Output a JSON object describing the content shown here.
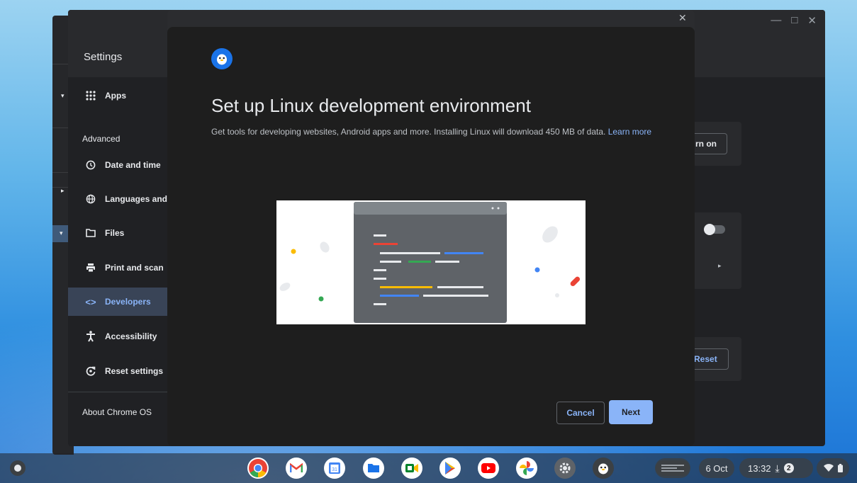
{
  "settings": {
    "title": "Settings",
    "sidebar": {
      "apps_label": "Apps",
      "advanced_heading": "Advanced",
      "items": [
        {
          "label": "Date and time",
          "icon": "clock-icon"
        },
        {
          "label": "Languages and",
          "icon": "globe-icon"
        },
        {
          "label": "Files",
          "icon": "folder-icon"
        },
        {
          "label": "Print and scan",
          "icon": "printer-icon"
        },
        {
          "label": "Developers",
          "icon": "code-icon"
        },
        {
          "label": "Accessibility",
          "icon": "accessibility-icon"
        },
        {
          "label": "Reset settings",
          "icon": "reset-icon"
        }
      ],
      "about_label": "About Chrome OS"
    },
    "content": {
      "turn_on_label": "rn on",
      "reset_label": "Reset"
    }
  },
  "dialog": {
    "title": "Set up Linux development environment",
    "description": "Get tools for developing websites, Android apps and more. Installing Linux will download 450 MB of data.",
    "learn_more": "Learn more",
    "cancel_label": "Cancel",
    "next_label": "Next"
  },
  "shelf": {
    "apps": [
      "Chrome",
      "Gmail",
      "Calendar",
      "Files",
      "Meet",
      "Play Store",
      "YouTube",
      "Photos",
      "Settings",
      "Terminal"
    ],
    "date": "6 Oct",
    "time": "13:32",
    "notification_count": "2"
  },
  "colors": {
    "accent": "#8ab4f8",
    "dialog_bg": "#1e1e1e",
    "window_bg": "#202124"
  }
}
